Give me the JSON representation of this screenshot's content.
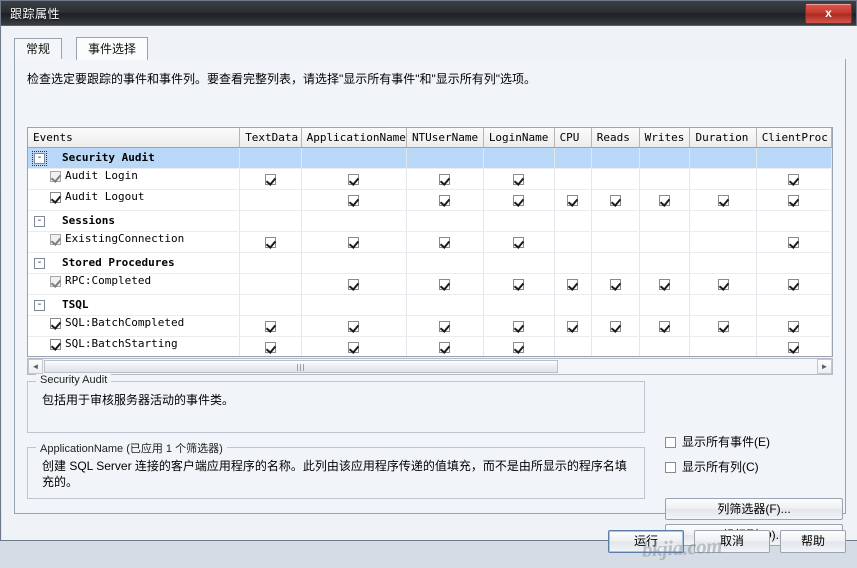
{
  "window": {
    "title": "跟踪属性",
    "close_label": "x"
  },
  "tabs": [
    {
      "label": "常规",
      "active": false
    },
    {
      "label": "事件选择",
      "active": true
    }
  ],
  "intro": "检查选定要跟踪的事件和事件列。要查看完整列表，请选择\"显示所有事件\"和\"显示所有列\"选项。",
  "grid": {
    "columns": [
      "Events",
      "TextData",
      "ApplicationName",
      "NTUserName",
      "LoginName",
      "CPU",
      "Reads",
      "Writes",
      "Duration",
      "ClientProc"
    ],
    "rows": [
      {
        "kind": "category",
        "label": "Security Audit",
        "selected": true,
        "expander": "-",
        "checks": []
      },
      {
        "kind": "event",
        "label": "Audit Login",
        "selected": false,
        "row_check": {
          "on": true,
          "enabled": false
        },
        "checks": [
          {
            "on": true,
            "enabled": true
          },
          {
            "on": true,
            "enabled": true
          },
          {
            "on": true,
            "enabled": true
          },
          {
            "on": true,
            "enabled": true
          },
          {
            "on": false,
            "enabled": true
          },
          {
            "on": false,
            "enabled": true
          },
          {
            "on": false,
            "enabled": true
          },
          {
            "on": false,
            "enabled": true
          },
          {
            "on": true,
            "enabled": true
          }
        ]
      },
      {
        "kind": "event",
        "label": "Audit Logout",
        "selected": false,
        "row_check": {
          "on": true,
          "enabled": true
        },
        "checks": [
          {
            "on": false,
            "enabled": true
          },
          {
            "on": true,
            "enabled": true
          },
          {
            "on": true,
            "enabled": true
          },
          {
            "on": true,
            "enabled": true
          },
          {
            "on": true,
            "enabled": true
          },
          {
            "on": true,
            "enabled": true
          },
          {
            "on": true,
            "enabled": true
          },
          {
            "on": true,
            "enabled": true
          },
          {
            "on": true,
            "enabled": true
          }
        ]
      },
      {
        "kind": "category",
        "label": "Sessions",
        "selected": false,
        "expander": "-",
        "checks": []
      },
      {
        "kind": "event",
        "label": "ExistingConnection",
        "selected": false,
        "row_check": {
          "on": true,
          "enabled": false
        },
        "checks": [
          {
            "on": true,
            "enabled": true
          },
          {
            "on": true,
            "enabled": true
          },
          {
            "on": true,
            "enabled": true
          },
          {
            "on": true,
            "enabled": true
          },
          {
            "on": false,
            "enabled": true
          },
          {
            "on": false,
            "enabled": true
          },
          {
            "on": false,
            "enabled": true
          },
          {
            "on": false,
            "enabled": true
          },
          {
            "on": true,
            "enabled": true
          }
        ]
      },
      {
        "kind": "category",
        "label": "Stored Procedures",
        "selected": false,
        "expander": "-",
        "checks": []
      },
      {
        "kind": "event",
        "label": "RPC:Completed",
        "selected": false,
        "row_check": {
          "on": true,
          "enabled": false
        },
        "checks": [
          {
            "on": false,
            "enabled": true
          },
          {
            "on": true,
            "enabled": true
          },
          {
            "on": true,
            "enabled": true
          },
          {
            "on": true,
            "enabled": true
          },
          {
            "on": true,
            "enabled": true
          },
          {
            "on": true,
            "enabled": true
          },
          {
            "on": true,
            "enabled": true
          },
          {
            "on": true,
            "enabled": true
          },
          {
            "on": true,
            "enabled": true
          }
        ]
      },
      {
        "kind": "category",
        "label": "TSQL",
        "selected": false,
        "expander": "-",
        "checks": []
      },
      {
        "kind": "event",
        "label": "SQL:BatchCompleted",
        "selected": false,
        "row_check": {
          "on": true,
          "enabled": true
        },
        "checks": [
          {
            "on": true,
            "enabled": true
          },
          {
            "on": true,
            "enabled": true
          },
          {
            "on": true,
            "enabled": true
          },
          {
            "on": true,
            "enabled": true
          },
          {
            "on": true,
            "enabled": true
          },
          {
            "on": true,
            "enabled": true
          },
          {
            "on": true,
            "enabled": true
          },
          {
            "on": true,
            "enabled": true
          },
          {
            "on": true,
            "enabled": true
          }
        ]
      },
      {
        "kind": "event",
        "label": "SQL:BatchStarting",
        "selected": false,
        "row_check": {
          "on": true,
          "enabled": true
        },
        "checks": [
          {
            "on": true,
            "enabled": true
          },
          {
            "on": true,
            "enabled": true
          },
          {
            "on": true,
            "enabled": true
          },
          {
            "on": true,
            "enabled": true
          },
          {
            "on": false,
            "enabled": true
          },
          {
            "on": false,
            "enabled": true
          },
          {
            "on": false,
            "enabled": true
          },
          {
            "on": false,
            "enabled": true
          },
          {
            "on": true,
            "enabled": true
          }
        ]
      }
    ]
  },
  "scrollbar": {
    "left_arrow": "◄",
    "right_arrow": "►"
  },
  "event_desc": {
    "title": "Security Audit",
    "text": "包括用于审核服务器活动的事件类。"
  },
  "column_desc": {
    "title": "ApplicationName (已应用 1 个筛选器)",
    "text": "创建 SQL Server 连接的客户端应用程序的名称。此列由该应用程序传递的值填充，而不是由所显示的程序名填充的。"
  },
  "options": {
    "show_all_events": {
      "label": "显示所有事件(E)",
      "checked": false
    },
    "show_all_columns": {
      "label": "显示所有列(C)",
      "checked": false
    }
  },
  "buttons": {
    "column_filters": "列筛选器(F)...",
    "organize_columns": "组织列(O)...",
    "run": "运行",
    "cancel": "取消",
    "help": "帮助"
  },
  "watermark": "bkjia.com",
  "colors": {
    "selection": "#b9d8f7",
    "close_button": "#c33a30",
    "titlebar": "#2b2e33"
  }
}
